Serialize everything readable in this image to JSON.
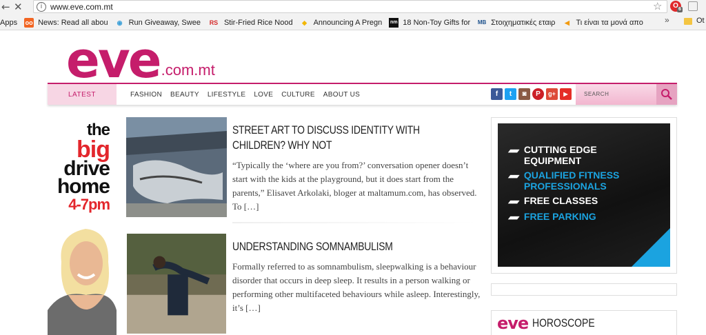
{
  "browser": {
    "url": "www.eve.com.mt",
    "extension_badge": "6",
    "bookmarks": [
      {
        "icon": "apps-icon",
        "label": "Apps"
      },
      {
        "icon": "news-icon",
        "label": "News: Read all abou"
      },
      {
        "icon": "giveaway-icon",
        "label": "Run Giveaway, Swee"
      },
      {
        "icon": "rs-icon",
        "label": "Stir-Fried Rice Nood"
      },
      {
        "icon": "duck-icon",
        "label": "Announcing A Pregn"
      },
      {
        "icon": "nm-icon",
        "label": "18 Non-Toy Gifts for"
      },
      {
        "icon": "bet-icon",
        "label": "Στοιχηματικές εταιρ"
      },
      {
        "icon": "arrow-bm-icon",
        "label": "Τι είναι τα μονά απο"
      }
    ],
    "bookmarks_more": "»",
    "other_bookmarks": "Ot"
  },
  "site": {
    "logo_main": "eve",
    "logo_domain": ".com.mt",
    "nav_latest": "LATEST",
    "nav_links": [
      "FASHION",
      "BEAUTY",
      "LIFESTYLE",
      "LOVE",
      "CULTURE",
      "ABOUT US"
    ],
    "search_placeholder": "SEARCH",
    "social": [
      {
        "name": "facebook-icon",
        "glyph": "f",
        "color": "#3b5998"
      },
      {
        "name": "twitter-icon",
        "glyph": "t",
        "color": "#1da1f2"
      },
      {
        "name": "instagram-icon",
        "glyph": "◙",
        "color": "#8a5a44"
      },
      {
        "name": "pinterest-icon",
        "glyph": "P",
        "color": "#cb2027"
      },
      {
        "name": "googleplus-icon",
        "glyph": "g+",
        "color": "#dd4b39"
      },
      {
        "name": "youtube-icon",
        "glyph": "▶",
        "color": "#e52d27"
      }
    ]
  },
  "sidebar_ad": {
    "the": "the",
    "big": "big",
    "drive": "drive",
    "home": "home",
    "time": "4-7pm"
  },
  "articles": [
    {
      "title": "STREET ART TO DISCUSS IDENTITY WITH CHILDREN? WHY NOT",
      "excerpt": "“Typically the ‘where are you from?’ conversation opener doesn’t start with the kids at the playground, but it does start from the parents,” Elisavet Arkolaki, bloger at maltamum.com, has observed. To […]"
    },
    {
      "title": "UNDERSTANDING SOMNAMBULISM",
      "excerpt": "Formally referred to as somnambulism, sleepwalking is a behaviour disorder that occurs in deep sleep. It results in a person walking or performing other multifaceted behaviours while asleep. Interestingly, it’s […]"
    }
  ],
  "gym_ad": {
    "lines": [
      {
        "text": "CUTTING EDGE EQUIPMENT",
        "color": "#ffffff"
      },
      {
        "text": "QUALIFIED FITNESS PROFESSIONALS",
        "color": "#1ba3e0"
      },
      {
        "text": "FREE CLASSES",
        "color": "#ffffff"
      },
      {
        "text": "FREE PARKING",
        "color": "#1ba3e0"
      }
    ]
  },
  "horoscope": {
    "logo": "eve",
    "title": "HOROSCOPE"
  }
}
